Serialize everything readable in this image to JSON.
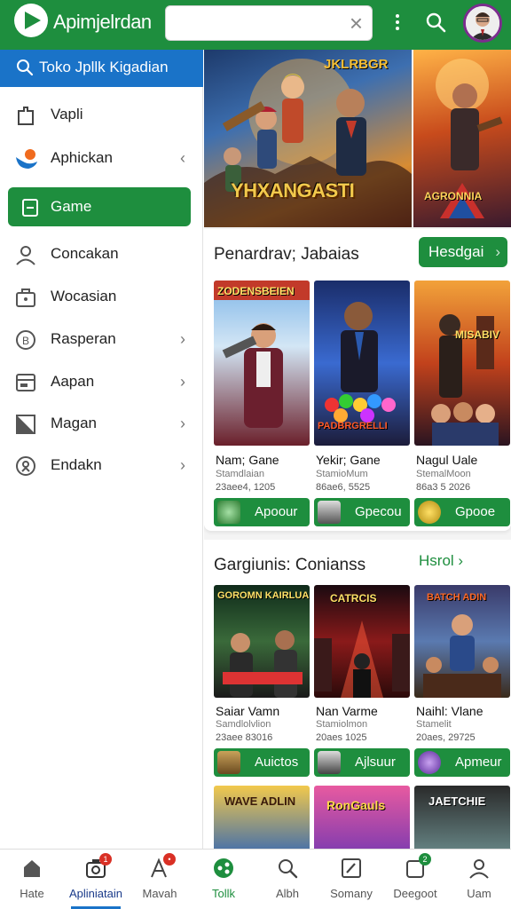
{
  "header": {
    "app_title": "Apimjelrdan",
    "search_value": "",
    "search_placeholder": ""
  },
  "sidebar": {
    "search_label": "Toko Jpllk Kigadian",
    "items": [
      {
        "label": "Vapli",
        "icon": "tag-icon",
        "chevron": ""
      },
      {
        "label": "Aphickan",
        "icon": "app-logo-icon",
        "chevron": "‹"
      },
      {
        "label": "Game",
        "icon": "square-icon",
        "chevron": "",
        "active": true
      },
      {
        "label": "Concakan",
        "icon": "person-icon",
        "chevron": ""
      },
      {
        "label": "Wocasian",
        "icon": "briefcase-icon",
        "chevron": ""
      },
      {
        "label": "Rasperan",
        "icon": "coin-icon",
        "chevron": "›"
      },
      {
        "label": "Aapan",
        "icon": "card-icon",
        "chevron": "›"
      },
      {
        "label": "Magan",
        "icon": "image-icon",
        "chevron": "›"
      },
      {
        "label": "Endakn",
        "icon": "award-icon",
        "chevron": "›"
      }
    ]
  },
  "banner": {
    "main_title": "YHXANGASTI",
    "top_text": "JKLRBGR",
    "side_title": "AGRONNIA"
  },
  "section1": {
    "title": "Penardrav; Jabaias",
    "button_label": "Hesdgai",
    "button_arrow": "›",
    "cards": [
      {
        "thumb_text": "ZODENSBEIEN",
        "name": "Nam; Gane",
        "sub": "Stamdlaian",
        "date": "23aee4, 1205",
        "btn_label": "Apoour",
        "btn_icon": "globe-icon"
      },
      {
        "thumb_text": "PADBRGRELLI",
        "name": "Yekir; Gane",
        "sub": "StamioMum",
        "date": "86ae6, 5525",
        "btn_label": "Gpecou",
        "btn_icon": "face-icon"
      },
      {
        "thumb_text": "MISABIV",
        "name": "Nagul Uale",
        "sub": "StemalMoon",
        "date": "86a3 5 2026",
        "btn_label": "Gpooe",
        "btn_icon": "coin-icon"
      }
    ]
  },
  "section2": {
    "title": "Gargiunis: Conianss",
    "link_label": "Hsrol",
    "link_arrow": "›",
    "cards": [
      {
        "thumb_text": "GOROMN KAIRLUAN",
        "name": "Saiar Vamn",
        "sub": "Samdlolvlion",
        "date": "23aee 83016",
        "btn_label": "Auictos",
        "btn_icon": "crate-icon"
      },
      {
        "thumb_text": "CATRCIS",
        "name": "Nan Varme",
        "sub": "Stamiolmon",
        "date": "20aes 1025",
        "btn_label": "Ajlsuur",
        "btn_icon": "face-icon"
      },
      {
        "thumb_text": "BATCH ADIN",
        "name": "Naihl: Vlane",
        "sub": "Stamelit",
        "date": "20aes, 29725",
        "btn_label": "Apmeur",
        "btn_icon": "gem-icon"
      }
    ]
  },
  "section3": {
    "thumbs": [
      "WAVE ADLIN",
      "RonGauls",
      "JAETCHIE"
    ]
  },
  "bottom_nav": [
    {
      "label": "Hate",
      "icon": "home-icon",
      "badge": ""
    },
    {
      "label": "Apliniatain",
      "icon": "camera-icon",
      "badge": "1",
      "active": true
    },
    {
      "label": "Mavah",
      "icon": "pen-icon",
      "badge": "•"
    },
    {
      "label": "Tollk",
      "icon": "share-icon",
      "badge": "",
      "green": true
    },
    {
      "label": "Albh",
      "icon": "search-icon",
      "badge": ""
    },
    {
      "label": "Somany",
      "icon": "edit-icon",
      "badge": ""
    },
    {
      "label": "Deegoot",
      "icon": "tablet-icon",
      "badge": "2"
    },
    {
      "label": "Uam",
      "icon": "user-icon",
      "badge": ""
    }
  ],
  "colors": {
    "brand_green": "#1e8e3e",
    "accent_blue": "#1a73c8",
    "badge_red": "#d93025"
  }
}
